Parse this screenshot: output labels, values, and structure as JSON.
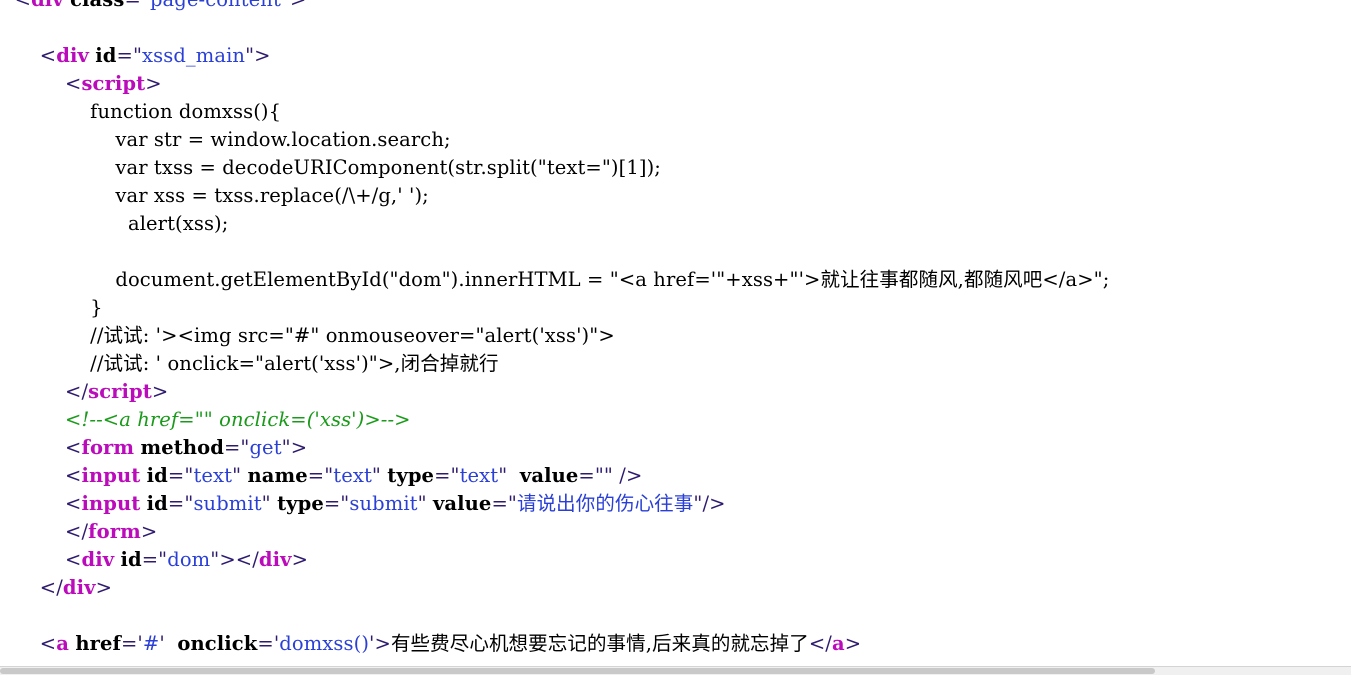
{
  "page": {
    "kind": "browser-view-source",
    "colors": {
      "background": "#ffffff",
      "bracket": "#2e1a6e",
      "tag_name": "#bb0cbb",
      "attribute_name": "#000000",
      "attribute_value": "#2a3fd6",
      "comment": "#1a9a1a",
      "plain_text": "#000000",
      "scrollbar_track": "#f0f0f0",
      "scrollbar_thumb": "#c9c9c9"
    }
  },
  "code": {
    "line_01": {
      "indent": "  ",
      "open_bracket": "<",
      "tag": "div",
      "space": " ",
      "attr": "class",
      "eq": "=",
      "quote_open": "\"",
      "value": "page-content",
      "quote_close": "\"",
      "close_bracket": ">"
    },
    "line_02": "",
    "line_03": {
      "indent": "      ",
      "open_bracket": "<",
      "tag": "div",
      "space": " ",
      "attr": "id",
      "eq": "=",
      "quote_open": "\"",
      "value": "xssd_main",
      "quote_close": "\"",
      "close_bracket": ">"
    },
    "line_04": {
      "indent": "          ",
      "open_bracket": "<",
      "tag": "script",
      "close_bracket": ">"
    },
    "line_05": "              function domxss(){",
    "line_06": "                  var str = window.location.search;",
    "line_07": "                  var txss = decodeURIComponent(str.split(\"text=\")[1]);",
    "line_08": "                  var xss = txss.replace(/\\+/g,' ');",
    "line_09": "                    alert(xss);",
    "line_10": "",
    "line_11": "                  document.getElementById(\"dom\").innerHTML = \"<a href='\"+xss+\"'>就让往事都随风,都随风吧</a>\";",
    "line_12": "              }",
    "line_13": "              //试试: '><img src=\"#\" onmouseover=\"alert('xss')\">",
    "line_14": "              //试试: ' onclick=\"alert('xss')\">,闭合掉就行",
    "line_15": {
      "indent": "          ",
      "open_bracket": "</",
      "tag": "script",
      "close_bracket": ">"
    },
    "line_16": {
      "indent": "          ",
      "comment": "<!--<a href=\"\" onclick=('xss')>-->"
    },
    "line_17": {
      "indent": "          ",
      "open_bracket": "<",
      "tag": "form",
      "space": " ",
      "attr": "method",
      "eq": "=",
      "quote_open": "\"",
      "value": "get",
      "quote_close": "\"",
      "close_bracket": ">"
    },
    "line_18": {
      "indent": "          ",
      "open_bracket": "<",
      "tag": "input",
      "attr1": "id",
      "value1": "text",
      "attr2": "name",
      "value2": "text",
      "attr3": "type",
      "value3": "text",
      "attr4": "value",
      "value4": "",
      "close_bracket": "/>"
    },
    "line_19": {
      "indent": "          ",
      "open_bracket": "<",
      "tag": "input",
      "attr1": "id",
      "value1": "submit",
      "attr2": "type",
      "value2": "submit",
      "attr3": "value",
      "value3": "请说出你的伤心往事",
      "close_bracket": "/>"
    },
    "line_20": {
      "indent": "          ",
      "open_bracket": "</",
      "tag": "form",
      "close_bracket": ">"
    },
    "line_21": {
      "indent": "          ",
      "open_bracket": "<",
      "tag": "div",
      "attr": "id",
      "value": "dom",
      "mid_bracket": ">",
      "close_open": "</",
      "close_tag": "div",
      "close_bracket": ">"
    },
    "line_22": {
      "indent": "      ",
      "open_bracket": "</",
      "tag": "div",
      "close_bracket": ">"
    },
    "line_23": "",
    "line_24": {
      "indent": "      ",
      "open_bracket": "<",
      "tag": "a",
      "attr1": "href",
      "value1": "#",
      "attr2": "onclick",
      "value2": "domxss()",
      "mid_bracket": ">",
      "text": "有些费尽心机想要忘记的事情,后来真的就忘掉了",
      "close_open": "</",
      "close_tag": "a",
      "close_bracket": ">"
    }
  },
  "scrollbar": {
    "orientation": "horizontal",
    "position": "bottom"
  }
}
